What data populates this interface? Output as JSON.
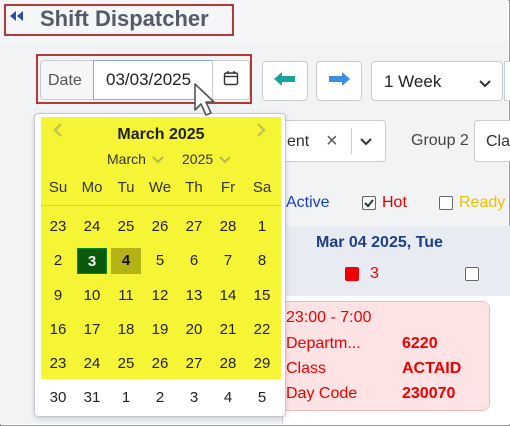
{
  "app": {
    "title": "Shift Dispatcher",
    "back_icon": "double-chevron-left-icon"
  },
  "toolbar": {
    "date_label": "Date",
    "date_value": "03/03/2025",
    "calendar_icon": "calendar-icon",
    "prev_icon": "arrow-left-icon",
    "next_icon": "arrow-right-icon",
    "range_value": "1 Week",
    "prev_color": "#1aa39a",
    "next_color": "#3b8fe0"
  },
  "filters": {
    "group1_value": "ent",
    "group2_label": "Group 2",
    "group2_value": "Cla"
  },
  "legend": {
    "active_label": "Active",
    "hot_label": "Hot",
    "ready_label": "Ready",
    "active_color": "#1a3fd0",
    "hot_color": "#e00000",
    "ready_color": "#f0c000"
  },
  "schedule": {
    "day_header": "Mar 04 2025, Tue",
    "count": "3",
    "card": {
      "time": "23:00 - 7:00",
      "rows": [
        {
          "label": "Departm...",
          "value": "6220"
        },
        {
          "label": "Class",
          "value": "ACTAID"
        },
        {
          "label": "Day Code",
          "value": "230070"
        }
      ]
    }
  },
  "calendar": {
    "month_title": "March 2025",
    "month_select": "March",
    "year_select": "2025",
    "weekdays": [
      "Su",
      "Mo",
      "Tu",
      "We",
      "Th",
      "Fr",
      "Sa"
    ],
    "weeks": [
      [
        "23",
        "24",
        "25",
        "26",
        "27",
        "28",
        "1"
      ],
      [
        "2",
        "3",
        "4",
        "5",
        "6",
        "7",
        "8"
      ],
      [
        "9",
        "10",
        "11",
        "12",
        "13",
        "14",
        "15"
      ],
      [
        "16",
        "17",
        "18",
        "19",
        "20",
        "21",
        "22"
      ],
      [
        "23",
        "24",
        "25",
        "26",
        "27",
        "28",
        "29"
      ],
      [
        "30",
        "31",
        "1",
        "2",
        "3",
        "4",
        "5"
      ]
    ],
    "selected_day": "3",
    "today_day": "4",
    "highlight_color": "#f5f536",
    "selected_color": "#0b5a0b",
    "today_color": "#b3b315"
  }
}
